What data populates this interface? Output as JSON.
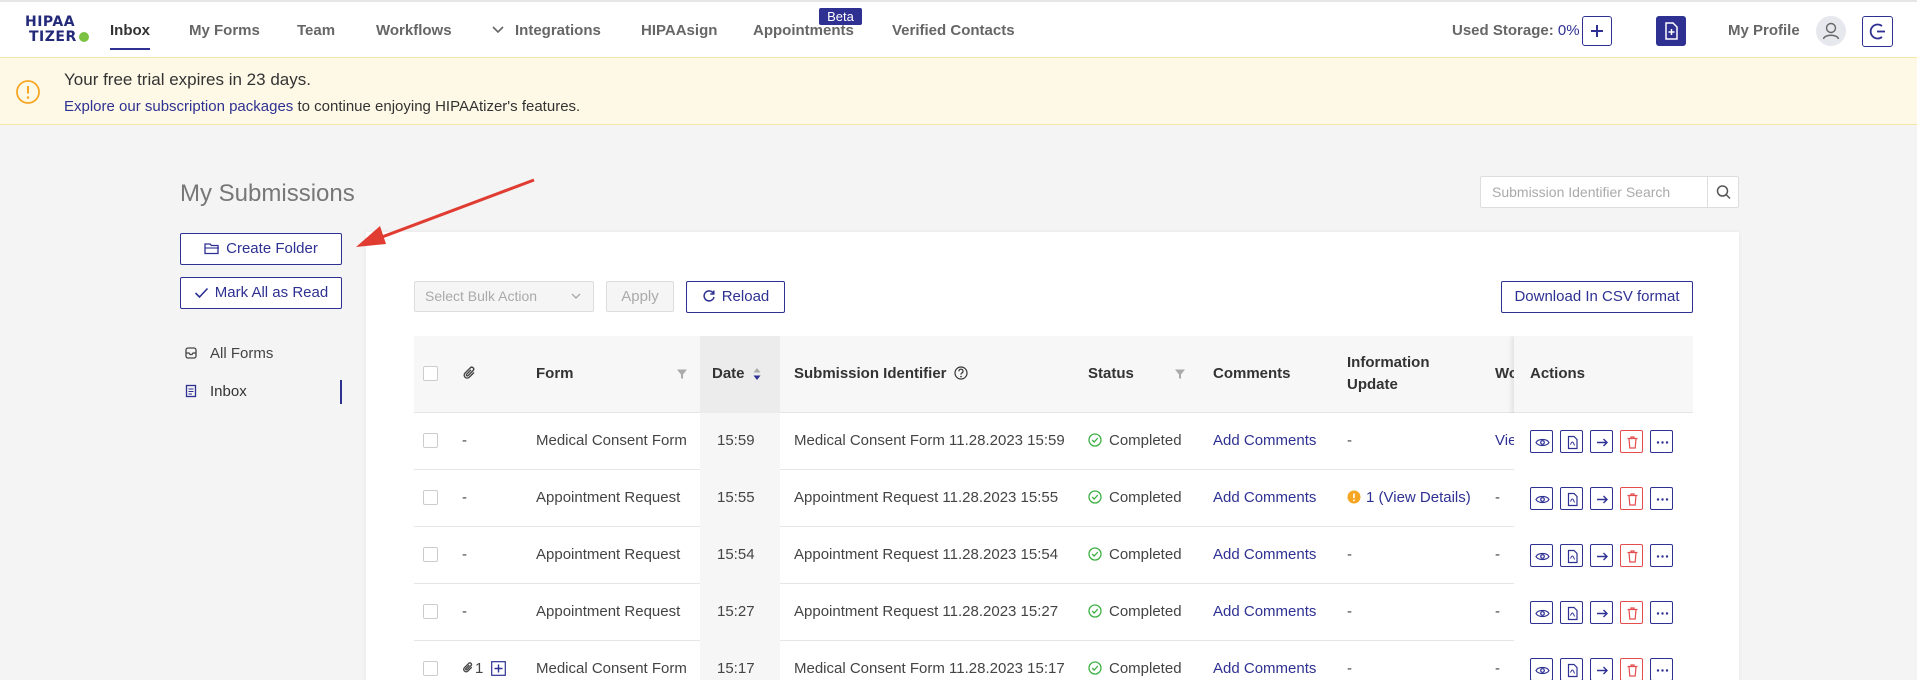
{
  "brand": {
    "line1": "HIPAA",
    "line2": "TIZER"
  },
  "nav": {
    "items": [
      "Inbox",
      "My Forms",
      "Team",
      "Workflows",
      "Integrations",
      "HIPAAsign",
      "Appointments",
      "Verified Contacts"
    ],
    "beta_label": "Beta"
  },
  "header": {
    "storage_label": "Used Storage:",
    "storage_value": "0%",
    "profile_label": "My Profile"
  },
  "banner": {
    "title": "Your free trial expires in 23 days.",
    "link_text": "Explore our subscription packages",
    "tail_text": " to continue enjoying HIPAAtizer's features."
  },
  "page": {
    "title": "My Submissions"
  },
  "search": {
    "placeholder": "Submission Identifier Search"
  },
  "sidebar": {
    "create_folder": "Create Folder",
    "mark_all_read": "Mark All as Read",
    "items": [
      "All Forms",
      "Inbox"
    ]
  },
  "toolbar": {
    "bulk_placeholder": "Select Bulk Action",
    "apply": "Apply",
    "reload": "Reload",
    "csv": "Download In CSV format"
  },
  "table": {
    "headers": {
      "form": "Form",
      "date": "Date",
      "identifier": "Submission Identifier",
      "status": "Status",
      "comments": "Comments",
      "info_update_1": "Information",
      "info_update_2": "Update",
      "workflow": "Wo",
      "actions": "Actions"
    },
    "rows": [
      {
        "attach": "-",
        "form": "Medical Consent Form",
        "date": "15:59",
        "identifier": "Medical Consent Form 11.28.2023 15:59",
        "status": "Completed",
        "comments": "Add Comments",
        "info": "-",
        "workflow": "Vie"
      },
      {
        "attach": "-",
        "form": "Appointment Request",
        "date": "15:55",
        "identifier": "Appointment Request 11.28.2023 15:55",
        "status": "Completed",
        "comments": "Add Comments",
        "info": "1 (View Details)",
        "workflow": "-"
      },
      {
        "attach": "-",
        "form": "Appointment Request",
        "date": "15:54",
        "identifier": "Appointment Request 11.28.2023 15:54",
        "status": "Completed",
        "comments": "Add Comments",
        "info": "-",
        "workflow": "-"
      },
      {
        "attach": "-",
        "form": "Appointment Request",
        "date": "15:27",
        "identifier": "Appointment Request 11.28.2023 15:27",
        "status": "Completed",
        "comments": "Add Comments",
        "info": "-",
        "workflow": "-"
      },
      {
        "attach": "1",
        "form": "Medical Consent Form",
        "date": "15:17",
        "identifier": "Medical Consent Form 11.28.2023 15:17",
        "status": "Completed",
        "comments": "Add Comments",
        "info": "-",
        "workflow": "-"
      }
    ]
  },
  "colors": {
    "accent": "#2e3192",
    "success": "#3cb043",
    "danger": "#e34d4d",
    "warning": "#f5a623",
    "annotation": "#e03c31"
  }
}
